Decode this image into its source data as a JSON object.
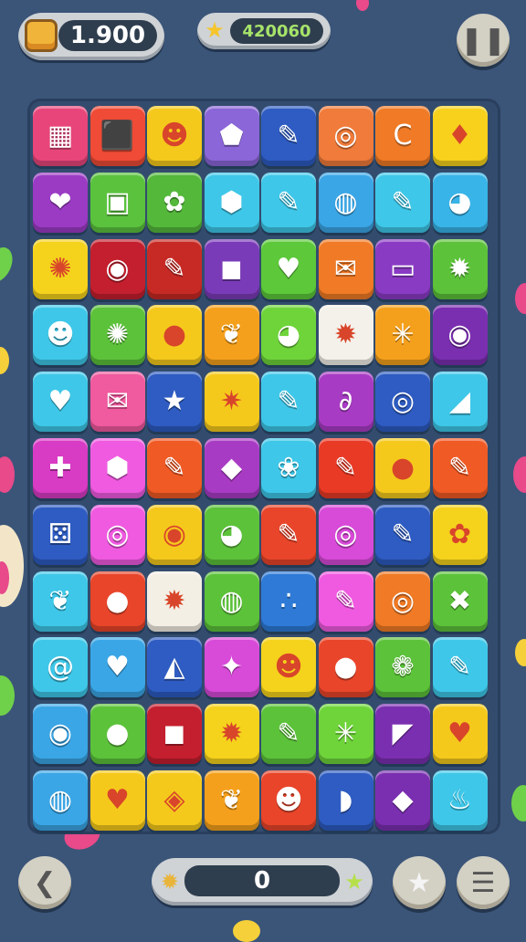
{
  "hud": {
    "coins": "1.900",
    "coins_icon": "coin-stack-icon",
    "score": "420060",
    "score_icon": "star-icon",
    "pause_icon": "pause-icon"
  },
  "board": {
    "rows": 11,
    "cols": 8,
    "tiles": [
      [
        {
          "c": "#e8467a",
          "i": "▦"
        },
        {
          "c": "#ef4b37",
          "i": "⬛"
        },
        {
          "c": "#f5c91c",
          "i": "☻"
        },
        {
          "c": "#8a66d8",
          "i": "⬟"
        },
        {
          "c": "#2e5cc2",
          "i": "✎"
        },
        {
          "c": "#f07b3a",
          "i": "◎"
        },
        {
          "c": "#f07a25",
          "i": "C"
        },
        {
          "c": "#f7d11c",
          "i": "♦"
        }
      ],
      [
        {
          "c": "#9b3bc4",
          "i": "❤"
        },
        {
          "c": "#5bc23e",
          "i": "▣"
        },
        {
          "c": "#54b83b",
          "i": "✿"
        },
        {
          "c": "#3ec7e8",
          "i": "⬢"
        },
        {
          "c": "#3ec7e8",
          "i": "✎"
        },
        {
          "c": "#3aa6e6",
          "i": "◍"
        },
        {
          "c": "#3ec7e8",
          "i": "✎"
        },
        {
          "c": "#38b4e8",
          "i": "◕"
        }
      ],
      [
        {
          "c": "#f5d21c",
          "i": "✺"
        },
        {
          "c": "#c41f2e",
          "i": "◉"
        },
        {
          "c": "#c72a25",
          "i": "✎"
        },
        {
          "c": "#7a3bb8",
          "i": "◼"
        },
        {
          "c": "#5cc83a",
          "i": "♥"
        },
        {
          "c": "#f07a25",
          "i": "✉"
        },
        {
          "c": "#8a3bc4",
          "i": "▭"
        },
        {
          "c": "#5cc23a",
          "i": "✹"
        }
      ],
      [
        {
          "c": "#3ec7e8",
          "i": "☻"
        },
        {
          "c": "#5cc23a",
          "i": "✺"
        },
        {
          "c": "#f5c91c",
          "i": "●"
        },
        {
          "c": "#f5a01c",
          "i": "❦"
        },
        {
          "c": "#6ed43a",
          "i": "◕"
        },
        {
          "c": "#f4f1ea",
          "i": "✹"
        },
        {
          "c": "#f5a01c",
          "i": "✳"
        },
        {
          "c": "#7a2fb0",
          "i": "◉"
        }
      ],
      [
        {
          "c": "#3ec7e8",
          "i": "♥"
        },
        {
          "c": "#f05a9e",
          "i": "✉"
        },
        {
          "c": "#2e5cc2",
          "i": "★"
        },
        {
          "c": "#f5c91c",
          "i": "✷"
        },
        {
          "c": "#3ec7e8",
          "i": "✎"
        },
        {
          "c": "#a83bc4",
          "i": "∂"
        },
        {
          "c": "#2e5cc2",
          "i": "◎"
        },
        {
          "c": "#3ec7e8",
          "i": "◢"
        }
      ],
      [
        {
          "c": "#d83bc4",
          "i": "✚"
        },
        {
          "c": "#f05ae0",
          "i": "⬢"
        },
        {
          "c": "#f05a25",
          "i": "✎"
        },
        {
          "c": "#a83bc4",
          "i": "◆"
        },
        {
          "c": "#3ec7e8",
          "i": "❀"
        },
        {
          "c": "#e83a25",
          "i": "✎"
        },
        {
          "c": "#f5c91c",
          "i": "●"
        },
        {
          "c": "#f05a25",
          "i": "✎"
        }
      ],
      [
        {
          "c": "#2e5cc2",
          "i": "⚄"
        },
        {
          "c": "#f05ae0",
          "i": "◎"
        },
        {
          "c": "#f5c91c",
          "i": "◉"
        },
        {
          "c": "#5cc23a",
          "i": "◕"
        },
        {
          "c": "#e8452a",
          "i": "✎"
        },
        {
          "c": "#d84ad8",
          "i": "◎"
        },
        {
          "c": "#2e5cc2",
          "i": "✎"
        },
        {
          "c": "#f5d21c",
          "i": "✿"
        }
      ],
      [
        {
          "c": "#3ec7e8",
          "i": "❦"
        },
        {
          "c": "#e8452a",
          "i": "●"
        },
        {
          "c": "#f4efe4",
          "i": "✹"
        },
        {
          "c": "#5cc23a",
          "i": "◍"
        },
        {
          "c": "#2e7ad6",
          "i": "∴"
        },
        {
          "c": "#f05ae0",
          "i": "✎"
        },
        {
          "c": "#f07a25",
          "i": "◎"
        },
        {
          "c": "#5cc23a",
          "i": "✖"
        }
      ],
      [
        {
          "c": "#3ec7e8",
          "i": "@"
        },
        {
          "c": "#3aa6e6",
          "i": "♥"
        },
        {
          "c": "#2e5cc2",
          "i": "◭"
        },
        {
          "c": "#d84ad8",
          "i": "✦"
        },
        {
          "c": "#f5d21c",
          "i": "☻"
        },
        {
          "c": "#e8452a",
          "i": "●"
        },
        {
          "c": "#5cc23a",
          "i": "❁"
        },
        {
          "c": "#3ec7e8",
          "i": "✎"
        }
      ],
      [
        {
          "c": "#3aa6e6",
          "i": "◉"
        },
        {
          "c": "#5cc23a",
          "i": "●"
        },
        {
          "c": "#c41f2e",
          "i": "◼"
        },
        {
          "c": "#f5d21c",
          "i": "✹"
        },
        {
          "c": "#5cc23a",
          "i": "✎"
        },
        {
          "c": "#6ed43a",
          "i": "✳"
        },
        {
          "c": "#7a2fb0",
          "i": "◤"
        },
        {
          "c": "#f5c91c",
          "i": "♥"
        }
      ],
      [
        {
          "c": "#3aa6e6",
          "i": "◍"
        },
        {
          "c": "#f5c91c",
          "i": "♥"
        },
        {
          "c": "#f5c91c",
          "i": "◈"
        },
        {
          "c": "#f5a01c",
          "i": "❦"
        },
        {
          "c": "#e8452a",
          "i": "☻"
        },
        {
          "c": "#2e5cc2",
          "i": "◗"
        },
        {
          "c": "#7a2fb0",
          "i": "◆"
        },
        {
          "c": "#3ec7e8",
          "i": "♨"
        }
      ]
    ]
  },
  "bottom": {
    "back_icon": "back-arrow-icon",
    "counter": "0",
    "star_icon": "star-icon",
    "menu_icon": "menu-icon"
  }
}
